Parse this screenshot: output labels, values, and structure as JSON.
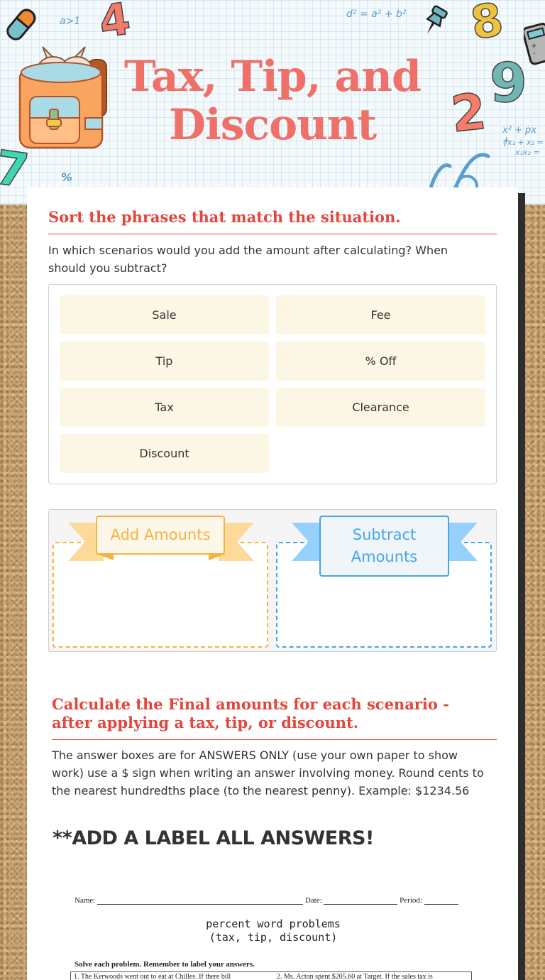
{
  "header": {
    "title": "Tax, Tip, and Discount",
    "decorations": {
      "formula_a": "a>1",
      "formula_pythag": "d² = a² + b²",
      "formula_quad_1": "x² + px +",
      "formula_quad_2": "{x₁ + x₂ =",
      "formula_quad_3": "x₁x₂ =",
      "percent": "%",
      "digits": [
        "4",
        "8",
        "9",
        "2",
        "7"
      ]
    }
  },
  "sort_section": {
    "title": "Sort the phrases that match the situation.",
    "instructions": "In which scenarios would you add the amount after calculating? When should you subtract?",
    "chips": [
      "Sale",
      "Fee",
      "Tip",
      "% Off",
      "Tax",
      "Clearance",
      "Discount"
    ],
    "bins": [
      {
        "label": "Add Amounts",
        "color": "#f6b33d"
      },
      {
        "label": "Subtract Amounts",
        "color": "#45a6e8"
      }
    ]
  },
  "calc_section": {
    "title": "Calculate the Final amounts for each scenario - after applying a tax, tip, or discount.",
    "instructions": "The answer boxes are for ANSWERS ONLY (use your own paper to show work)  use a $ sign when writing an answer involving money. Round cents to the nearest hundredths place (to the nearest penny).  Example: $1234.56",
    "note": "**ADD A LABEL ALL ANSWERS!"
  },
  "worksheet": {
    "name_label": "Name:",
    "date_label": "Date:",
    "period_label": "Period:",
    "title_line1": "percent word problems",
    "title_line2": "(tax, tip, discount)",
    "instructions": "Solve each problem.  Remember to label your answers.",
    "problem_1": "1.  The Kerwoods went out to eat at Chilles.  If there bill",
    "problem_2": "2.  Ms. Acton spent $205.60 at Target.  If the sales tax is"
  },
  "colors": {
    "accent_red": "#e2463c",
    "title_coral": "#ef7068",
    "chip_bg": "#fcf6e5",
    "add_orange": "#f6b33d",
    "subtract_blue": "#45a6e8"
  }
}
